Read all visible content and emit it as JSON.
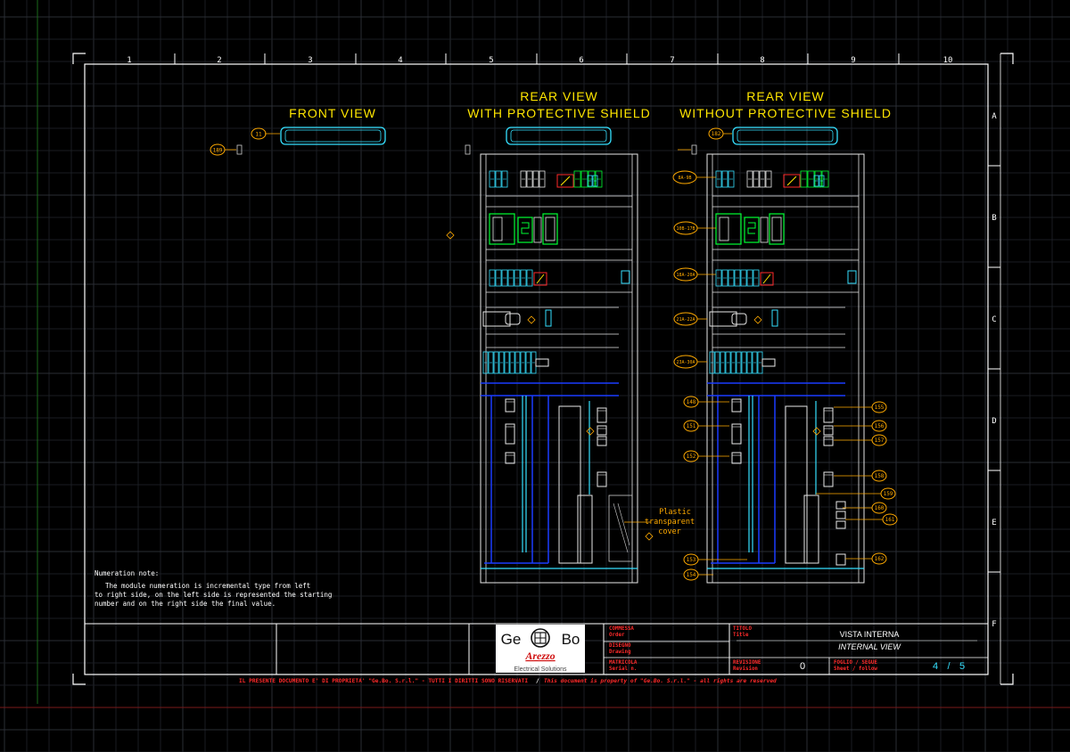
{
  "colors": {
    "background": "#000000",
    "grid_minor": "#1c1f24",
    "grid_major": "#2a2e35",
    "frame": "#ffffff",
    "title_text": "#ffe600",
    "callout": "#ffaa00",
    "cyan": "#35e0ff",
    "green": "#00ff33",
    "blue": "#1a3cff",
    "red": "#ff2a2a",
    "dark_red": "#b00000"
  },
  "column_labels": [
    "1",
    "2",
    "3",
    "4",
    "5",
    "6",
    "7",
    "8",
    "9",
    "10"
  ],
  "row_labels": [
    "A",
    "B",
    "C",
    "D",
    "E",
    "F"
  ],
  "views": {
    "front": {
      "line1": "FRONT VIEW",
      "line2": ""
    },
    "rear_with": {
      "line1": "REAR VIEW",
      "line2": "WITH PROTECTIVE SHIELD"
    },
    "rear_without": {
      "line1": "REAR VIEW",
      "line2": "WITHOUT PROTECTIVE SHIELD"
    }
  },
  "callouts": {
    "front_badge": "11",
    "front_left": "189",
    "rear_without_top": "182",
    "left_row1": "8A-9B",
    "left_row2": "10B-17B",
    "left_row3": "18A-20A",
    "left_row4": "21A-22A",
    "left_row5": "23A-30A",
    "left_d1": "148",
    "left_d2": "151",
    "left_d3": "152",
    "left_e1": "153",
    "left_e2": "154",
    "right_d1": "155",
    "right_d2": "156",
    "right_d3": "157",
    "right_d4": "158",
    "right_e1": "159",
    "right_e2": "160",
    "right_e3": "161",
    "right_e4": "162"
  },
  "plastic_note": {
    "line1": "Plastic",
    "line2": "transparent",
    "line3": "cover"
  },
  "numeration_note": {
    "title": "Numeration note:",
    "line1": "The module numeration is incremental type from left",
    "line2": "to right side, on the left side is represented the starting",
    "line3": "number and on the right side the final value."
  },
  "logo": {
    "left": "Ge",
    "right": "Bo",
    "city": "Arezzo",
    "tagline": "Electrical Solutions"
  },
  "title_block": {
    "commessa_label": "COMMESSA",
    "commessa_sub": "Order",
    "disegno_label": "DISEGNO",
    "disegno_sub": "Drawing",
    "matricola_label": "MATRICOLA",
    "matricola_sub": "Serial n.",
    "titolo_label": "TITOLO",
    "titolo_sub": "Title",
    "title_it": "VISTA INTERNA",
    "title_en": "INTERNAL VIEW",
    "revisione_label": "REVISIONE",
    "revisione_sub": "Revision",
    "revision_value": "0",
    "foglio_label": "FOGLIO / SEGUE",
    "foglio_sub": "Sheet / follow",
    "sheet": "4",
    "sheet_sep": "/",
    "sheet_total": "5"
  },
  "copyright": {
    "it": "IL PRESENTE DOCUMENTO E' DI PROPRIETA' \"Ge.Bo. S.r.l.\" - TUTTI I DIRITTI SONO RISERVATI",
    "sep": "/",
    "en": "This document is property of \"Ge.Bo. S.r.l.\" - all rights are reserved"
  }
}
